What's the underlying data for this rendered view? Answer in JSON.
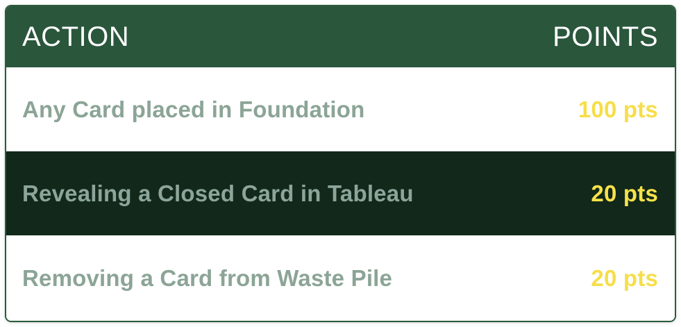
{
  "table": {
    "header": {
      "action": "ACTION",
      "points": "POINTS"
    },
    "rows": [
      {
        "action": "Any Card placed in Foundation",
        "points": "100 pts"
      },
      {
        "action": "Revealing a Closed Card in Tableau",
        "points": "20 pts"
      },
      {
        "action": "Removing a Card from Waste Pile",
        "points": "20 pts"
      }
    ]
  },
  "colors": {
    "header_background": "#2a563c",
    "dark_row_background": "#11281a",
    "action_text": "#8ba496",
    "points_text": "#f6de4a"
  }
}
